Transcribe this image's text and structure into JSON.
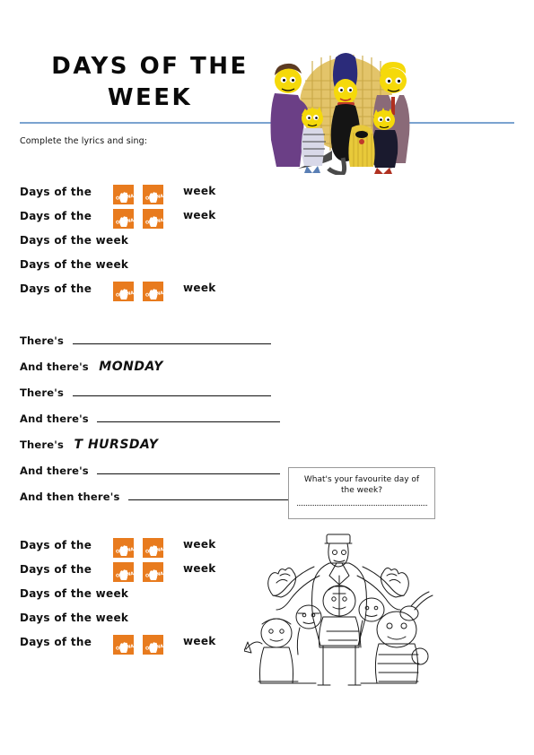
{
  "document": {
    "title_lines": [
      "DAYS OF THE",
      "WEEK"
    ],
    "instruction": "Complete the lyrics and sing:"
  },
  "images": {
    "top": {
      "name": "simpsons-addams-family-colour-illustration",
      "description": "Colour cartoon of the Simpsons family dressed as the Addams Family",
      "alt": "Simpsons as the Addams Family"
    },
    "bottom": {
      "name": "addams-family-line-art",
      "description": "Black and white coloring-book line drawing of a cartoon family group",
      "alt": "Line art cartoon family"
    }
  },
  "snap_icon": {
    "label": "Oh SNAP!",
    "color": "#e87b1e",
    "text_color": "#ffffff"
  },
  "lyrics_top": {
    "rows": [
      {
        "text": "Days of the",
        "snaps": 2,
        "trailing": "week"
      },
      {
        "text": "Days of the",
        "snaps": 2,
        "trailing": "week"
      },
      {
        "text": "Days of the week",
        "snaps": 0,
        "trailing": ""
      },
      {
        "text": "Days of the week",
        "snaps": 0,
        "trailing": ""
      },
      {
        "text": "Days of the",
        "snaps": 2,
        "trailing": "week"
      }
    ]
  },
  "lyrics_bottom": {
    "rows": [
      {
        "text": "Days of the",
        "snaps": 2,
        "trailing": "week"
      },
      {
        "text": "Days of the",
        "snaps": 2,
        "trailing": "week"
      },
      {
        "text": "Days of the week",
        "snaps": 0,
        "trailing": ""
      },
      {
        "text": "Days of the week",
        "snaps": 0,
        "trailing": ""
      },
      {
        "text": "Days of the",
        "snaps": 2,
        "trailing": "week"
      }
    ]
  },
  "fill_in": {
    "rows": [
      {
        "label": "There's",
        "answer": "",
        "blank": "long"
      },
      {
        "label": "And there's",
        "answer": "MONDAY",
        "blank": ""
      },
      {
        "label": "There's",
        "answer": "",
        "blank": "long"
      },
      {
        "label": "And there's",
        "answer": "",
        "blank": "med"
      },
      {
        "label": "There's",
        "answer": "T HURSDAY",
        "blank": ""
      },
      {
        "label": "And there's",
        "answer": "",
        "blank": "med"
      },
      {
        "label": "And then there's",
        "answer": "",
        "blank": "short"
      }
    ]
  },
  "question_box": {
    "question": "What's your favourite day of the week?",
    "answer_line": ""
  },
  "colors": {
    "rule": "#7ba3d0",
    "snap_orange": "#e87b1e",
    "text": "#111111",
    "box_border": "#9a9a9a"
  }
}
